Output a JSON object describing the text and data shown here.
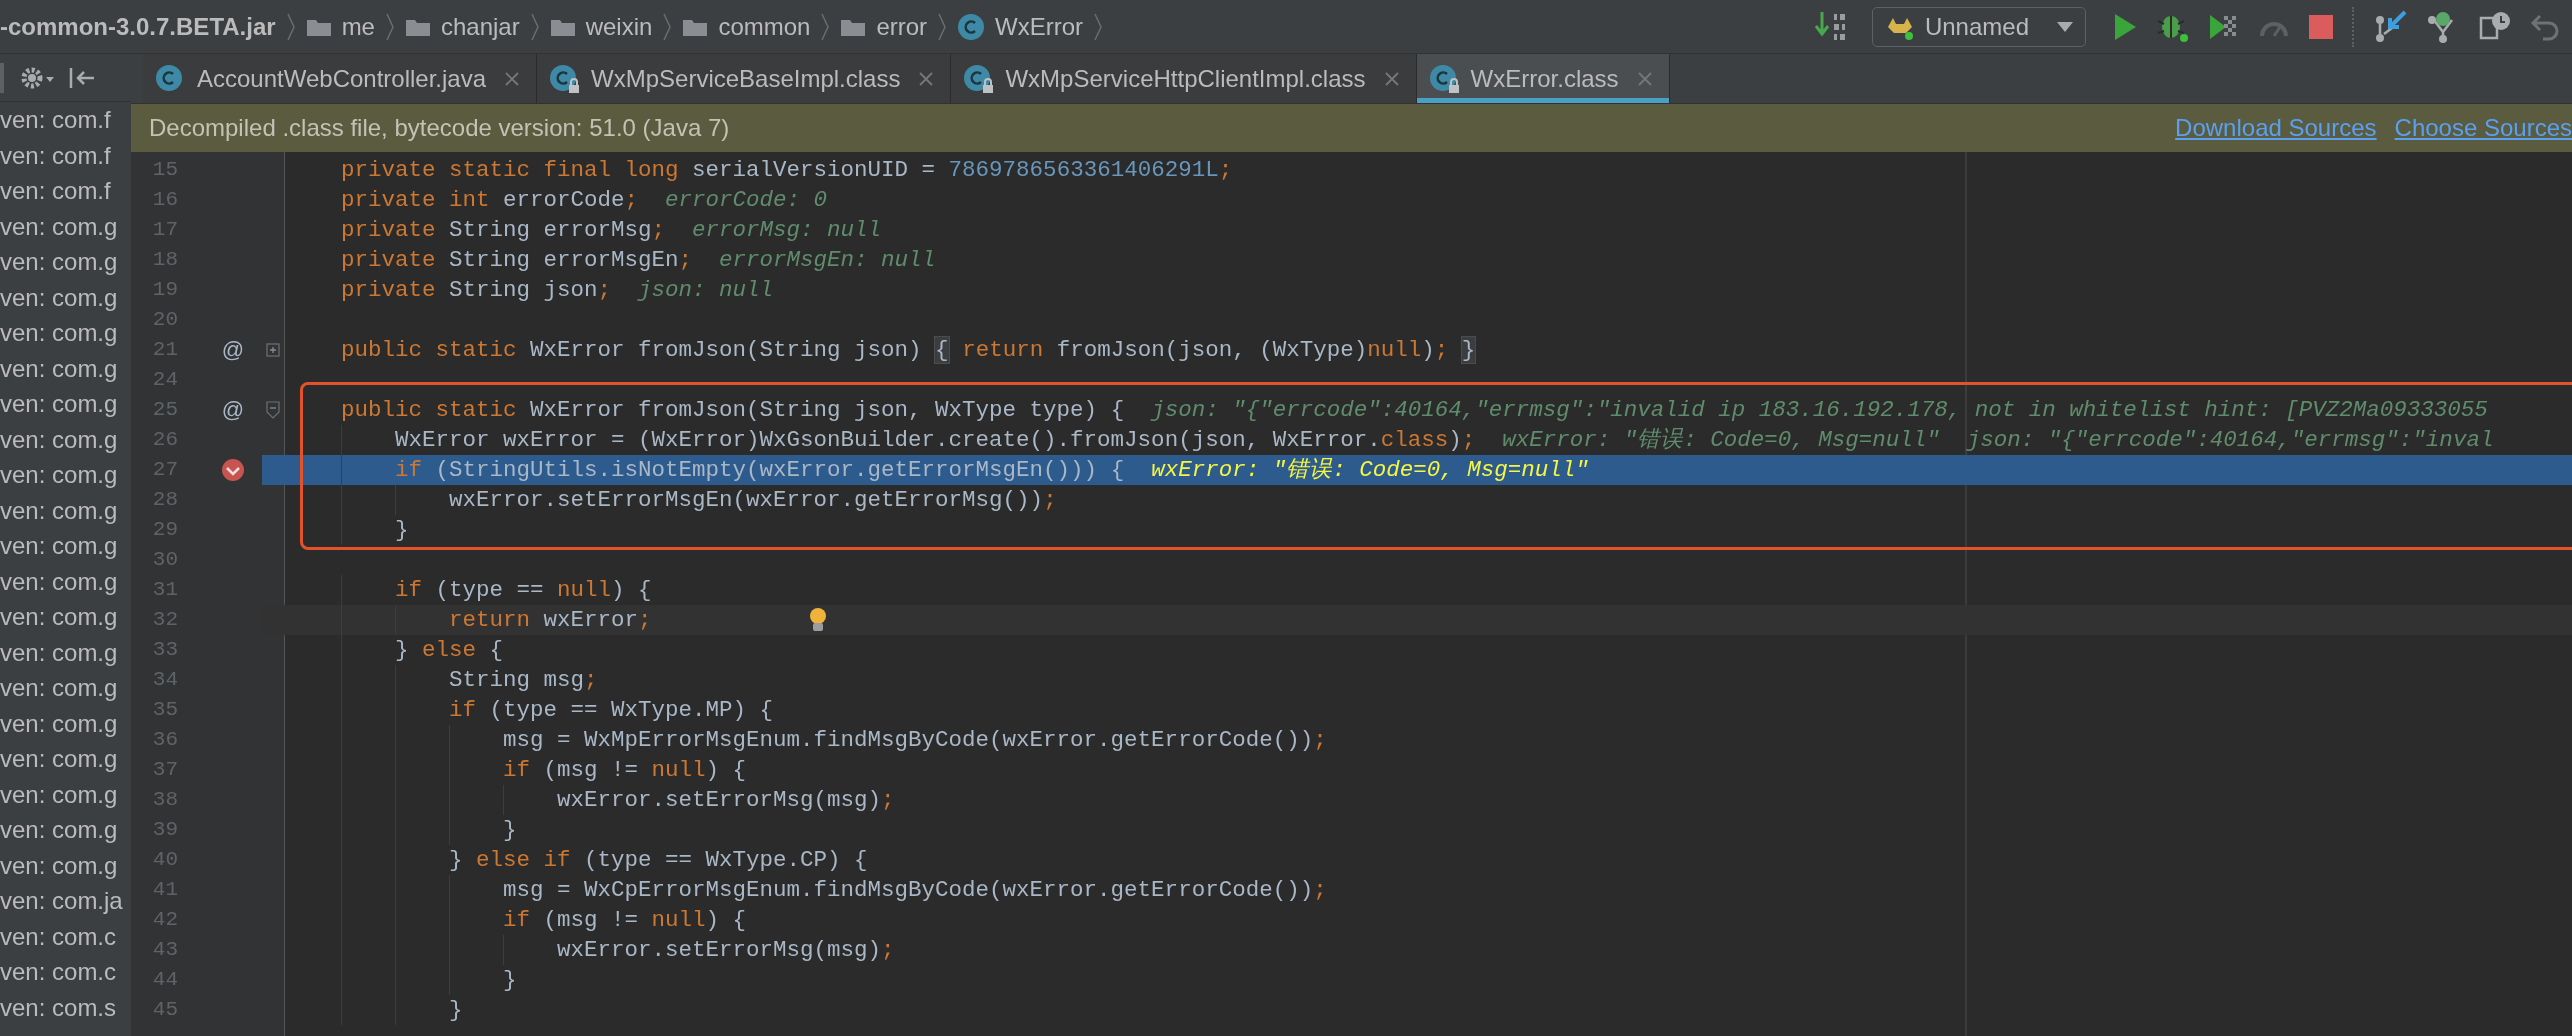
{
  "breadcrumbs": [
    {
      "label": "-common-3.0.7.BETA.jar",
      "kind": "jar"
    },
    {
      "label": "me",
      "kind": "folder"
    },
    {
      "label": "chanjar",
      "kind": "folder"
    },
    {
      "label": "weixin",
      "kind": "folder"
    },
    {
      "label": "common",
      "kind": "folder"
    },
    {
      "label": "error",
      "kind": "folder"
    },
    {
      "label": "WxError",
      "kind": "class"
    }
  ],
  "run_config": {
    "label": "Unnamed"
  },
  "project_items": [
    "ven: com.f",
    "ven: com.f",
    "ven: com.f",
    "ven: com.g",
    "ven: com.g",
    "ven: com.g",
    "ven: com.g",
    "ven: com.g",
    "ven: com.g",
    "ven: com.g",
    "ven: com.g",
    "ven: com.g",
    "ven: com.g",
    "ven: com.g",
    "ven: com.g",
    "ven: com.g",
    "ven: com.g",
    "ven: com.g",
    "ven: com.g",
    "ven: com.g",
    "ven: com.g",
    "ven: com.g",
    "ven: com.ja",
    "ven: com.c",
    "ven: com.c",
    "ven: com.s"
  ],
  "tabs": [
    {
      "label": "AccountWebController.java",
      "locked": false,
      "selected": false
    },
    {
      "label": "WxMpServiceBaseImpl.class",
      "locked": true,
      "selected": false
    },
    {
      "label": "WxMpServiceHttpClientImpl.class",
      "locked": true,
      "selected": false
    },
    {
      "label": "WxError.class",
      "locked": true,
      "selected": true
    }
  ],
  "notification": {
    "message": "Decompiled .class file, bytecode version: 51.0 (Java 7)",
    "actions": [
      "Download Sources",
      "Choose Sources"
    ]
  },
  "code_lines": [
    {
      "number": "15",
      "code": [
        {
          "kind": "kw",
          "text": "private static final long "
        },
        {
          "kind": "id",
          "text": "serialVersionUID = "
        },
        {
          "kind": "num",
          "text": "7869786563361406291L"
        },
        {
          "kind": "kw",
          "text": ";"
        }
      ]
    },
    {
      "number": "16",
      "code": [
        {
          "kind": "kw",
          "text": "private int "
        },
        {
          "kind": "id",
          "text": "errorCode"
        },
        {
          "kind": "kw",
          "text": ";"
        }
      ],
      "hints": [
        "errorCode: 0"
      ]
    },
    {
      "number": "17",
      "code": [
        {
          "kind": "kw",
          "text": "private "
        },
        {
          "kind": "id",
          "text": "String errorMsg"
        },
        {
          "kind": "kw",
          "text": ";"
        }
      ],
      "hints": [
        "errorMsg: null"
      ]
    },
    {
      "number": "18",
      "code": [
        {
          "kind": "kw",
          "text": "private "
        },
        {
          "kind": "id",
          "text": "String errorMsgEn"
        },
        {
          "kind": "kw",
          "text": ";"
        }
      ],
      "hints": [
        "errorMsgEn: null"
      ]
    },
    {
      "number": "19",
      "code": [
        {
          "kind": "kw",
          "text": "private "
        },
        {
          "kind": "id",
          "text": "String json"
        },
        {
          "kind": "kw",
          "text": ";"
        }
      ],
      "hints": [
        "json: null"
      ]
    },
    {
      "number": "20"
    },
    {
      "number": "21",
      "gutter_mark": "@",
      "folded": true,
      "code": [
        {
          "kind": "kw",
          "text": "public static "
        },
        {
          "kind": "id",
          "text": "WxError fromJson(String json) "
        },
        {
          "kind": "fold",
          "text": "{"
        },
        {
          "kind": "kw",
          "text": " return "
        },
        {
          "kind": "id",
          "text": "fromJson(json, (WxType)"
        },
        {
          "kind": "kw",
          "text": "null"
        },
        {
          "kind": "id",
          "text": ")"
        },
        {
          "kind": "kw",
          "text": "; "
        },
        {
          "kind": "fold",
          "text": "}"
        }
      ]
    },
    {
      "number": "24"
    },
    {
      "number": "25",
      "framed": true,
      "gutter_mark": "@",
      "folded": false,
      "code": [
        {
          "kind": "kw",
          "text": "public static "
        },
        {
          "kind": "id",
          "text": "WxError fromJson(String json, WxType type) {"
        }
      ],
      "hints": [
        "json: \"{\"errcode\":40164,\"errmsg\":\"invalid ip 183.16.192.178, not in whitelist hint: [PVZ2Ma09333055"
      ]
    },
    {
      "number": "26",
      "framed": true,
      "code": [
        {
          "kind": "id",
          "text": "    WxError wxError = (WxError)WxGsonBuilder.create().fromJson(json, WxError."
        },
        {
          "kind": "kw",
          "text": "class"
        },
        {
          "kind": "id",
          "text": ")"
        },
        {
          "kind": "kw",
          "text": ";"
        }
      ],
      "hints": [
        "wxError: \"错误: Code=0, Msg=null\"",
        "json: \"{\"errcode\":40164,\"errmsg\":\"inval"
      ]
    },
    {
      "number": "27",
      "current": true,
      "framed": true,
      "breakpoint": true,
      "code": [
        {
          "kind": "kw",
          "text": "    if "
        },
        {
          "kind": "id",
          "text": "(StringUtils.isNotEmpty(wxError.getErrorMsgEn())) {"
        }
      ],
      "hints": [
        "wxError: \"错误: Code=0, Msg=null\""
      ]
    },
    {
      "number": "28",
      "framed": true,
      "code": [
        {
          "kind": "id",
          "text": "        wxError.setErrorMsgEn(wxError.getErrorMsg())"
        },
        {
          "kind": "kw",
          "text": ";"
        }
      ]
    },
    {
      "number": "29",
      "framed": true,
      "code": [
        {
          "kind": "id",
          "text": "    }"
        }
      ]
    },
    {
      "number": "30"
    },
    {
      "number": "31",
      "code": [
        {
          "kind": "kw",
          "text": "    if "
        },
        {
          "kind": "id",
          "text": "(type == "
        },
        {
          "kind": "kw",
          "text": "null"
        },
        {
          "kind": "id",
          "text": ") {"
        }
      ]
    },
    {
      "number": "32",
      "caret": true,
      "bulb": true,
      "code": [
        {
          "kind": "kw",
          "text": "        return "
        },
        {
          "kind": "id",
          "text": "wxError"
        },
        {
          "kind": "kw",
          "text": ";"
        }
      ]
    },
    {
      "number": "33",
      "code": [
        {
          "kind": "id",
          "text": "    } "
        },
        {
          "kind": "kw",
          "text": "else "
        },
        {
          "kind": "id",
          "text": "{"
        }
      ]
    },
    {
      "number": "34",
      "code": [
        {
          "kind": "id",
          "text": "        String msg"
        },
        {
          "kind": "kw",
          "text": ";"
        }
      ]
    },
    {
      "number": "35",
      "code": [
        {
          "kind": "kw",
          "text": "        if "
        },
        {
          "kind": "id",
          "text": "(type == WxType.MP) {"
        }
      ]
    },
    {
      "number": "36",
      "code": [
        {
          "kind": "id",
          "text": "            msg = WxMpErrorMsgEnum.findMsgByCode(wxError.getErrorCode())"
        },
        {
          "kind": "kw",
          "text": ";"
        }
      ]
    },
    {
      "number": "37",
      "code": [
        {
          "kind": "kw",
          "text": "            if "
        },
        {
          "kind": "id",
          "text": "(msg != "
        },
        {
          "kind": "kw",
          "text": "null"
        },
        {
          "kind": "id",
          "text": ") {"
        }
      ]
    },
    {
      "number": "38",
      "code": [
        {
          "kind": "id",
          "text": "                wxError.setErrorMsg(msg)"
        },
        {
          "kind": "kw",
          "text": ";"
        }
      ]
    },
    {
      "number": "39",
      "code": [
        {
          "kind": "id",
          "text": "            }"
        }
      ]
    },
    {
      "number": "40",
      "code": [
        {
          "kind": "id",
          "text": "        } "
        },
        {
          "kind": "kw",
          "text": "else if "
        },
        {
          "kind": "id",
          "text": "(type == WxType.CP) {"
        }
      ]
    },
    {
      "number": "41",
      "code": [
        {
          "kind": "id",
          "text": "            msg = WxCpErrorMsgEnum.findMsgByCode(wxError.getErrorCode())"
        },
        {
          "kind": "kw",
          "text": ";"
        }
      ]
    },
    {
      "number": "42",
      "code": [
        {
          "kind": "kw",
          "text": "            if "
        },
        {
          "kind": "id",
          "text": "(msg != "
        },
        {
          "kind": "kw",
          "text": "null"
        },
        {
          "kind": "id",
          "text": ") {"
        }
      ]
    },
    {
      "number": "43",
      "code": [
        {
          "kind": "id",
          "text": "                wxError.setErrorMsg(msg)"
        },
        {
          "kind": "kw",
          "text": ";"
        }
      ]
    },
    {
      "number": "44",
      "code": [
        {
          "kind": "id",
          "text": "            }"
        }
      ]
    },
    {
      "number": "45",
      "code": [
        {
          "kind": "id",
          "text": "        }"
        }
      ]
    }
  ]
}
